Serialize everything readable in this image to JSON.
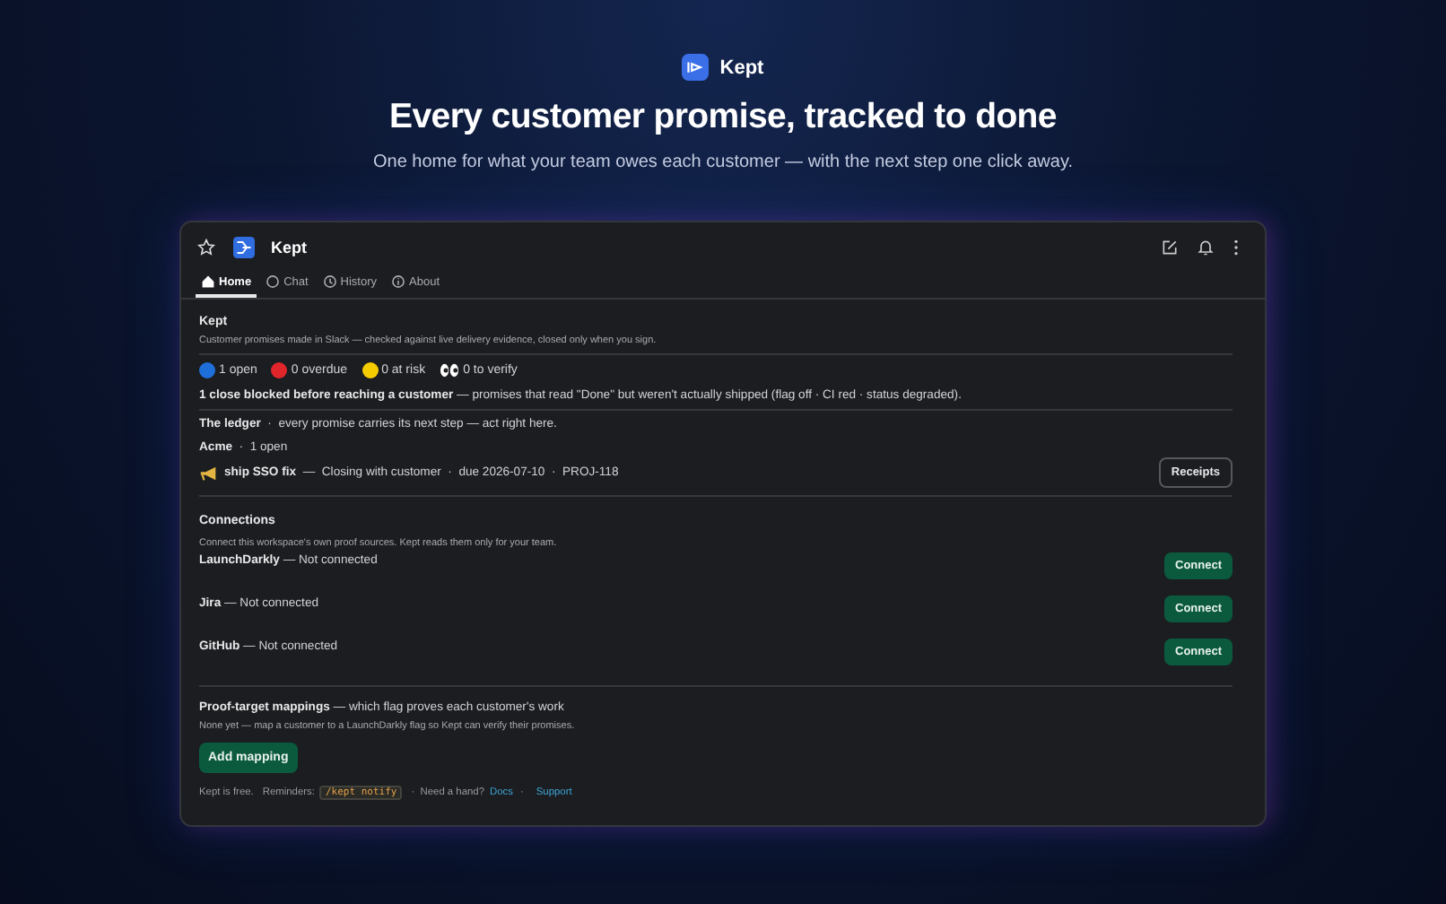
{
  "hero": {
    "brand": "Kept",
    "headline": "Every customer promise, tracked to done",
    "subtitle": "One home for what your team owes each customer — with the next step one click away."
  },
  "app": {
    "name": "Kept",
    "starred": false
  },
  "tabs": [
    {
      "label": "Home",
      "selected": true
    },
    {
      "label": "Chat",
      "selected": false
    },
    {
      "label": "History",
      "selected": false
    },
    {
      "label": "About",
      "selected": false
    }
  ],
  "intro": {
    "title": "Kept",
    "description": "Customer promises made in Slack — checked against live delivery evidence, closed only when you sign."
  },
  "stats": [
    {
      "kind": "dot",
      "color": "#1e6fd9",
      "text": "1 open"
    },
    {
      "kind": "dot",
      "color": "#e0262b",
      "text": "0 overdue"
    },
    {
      "kind": "dot",
      "color": "#f5cc00",
      "text": "0 at risk"
    },
    {
      "kind": "eyes",
      "text": "0 to verify"
    }
  ],
  "blocked": "**1 close blocked before reaching a customer** — promises that read \"Done\" but weren't actually shipped (flag off · CI red · status degraded).",
  "ledger": {
    "heading": "**The ledger**  ·  every promise carries its next step — act right here.",
    "customer": "**Acme**  ·  1 open",
    "items": [
      {
        "text": "**ship SSO fix**  —  Closing with customer  ·  due 2026-07-10  ·  PROJ-118",
        "action": "Receipts"
      }
    ]
  },
  "connections": {
    "title": "Connections",
    "description": "Connect this workspace's own proof sources. Kept reads them only for your team.",
    "items": [
      {
        "text": "**LaunchDarkly** — Not connected",
        "action": "Connect"
      },
      {
        "text": "**Jira** — Not connected",
        "action": "Connect"
      },
      {
        "text": "**GitHub** — Not connected",
        "action": "Connect"
      }
    ]
  },
  "mappings": {
    "heading": "**Proof-target mappings** — which flag proves each customer's work",
    "description": "None yet — map a customer to a LaunchDarkly flag so Kept can verify their promises.",
    "action": "Add mapping"
  },
  "footer": {
    "free": "Kept is free.",
    "reminders_label": "Reminders:",
    "command": "/kept notify",
    "help": "·  Need a hand?",
    "links": [
      "Docs",
      "Support"
    ],
    "link_separator": "·"
  }
}
